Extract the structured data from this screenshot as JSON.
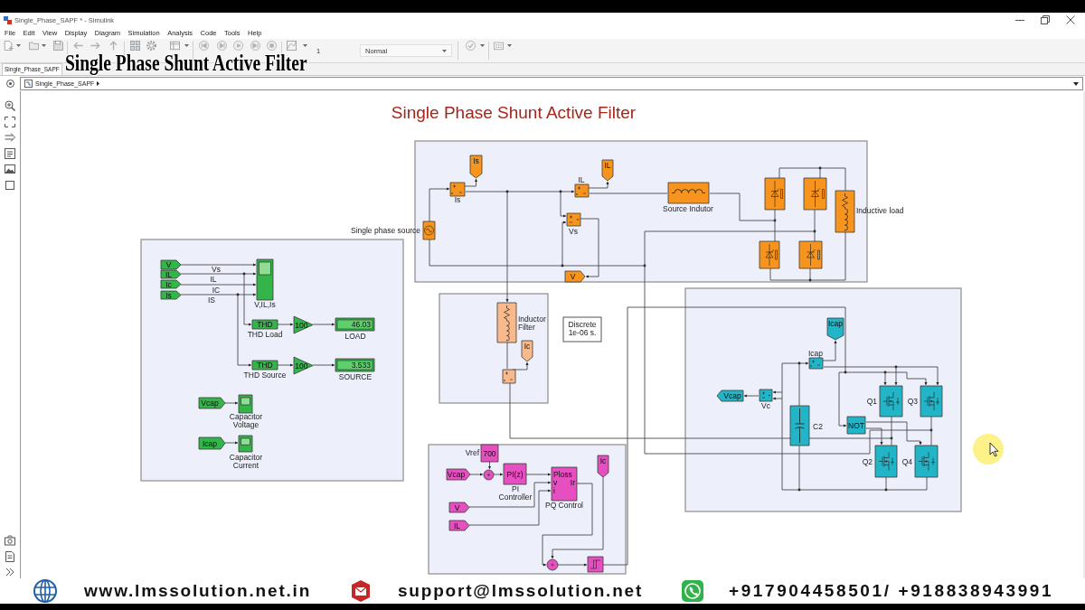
{
  "window": {
    "title": "Single_Phase_SAPF * - Simulink"
  },
  "menu": [
    "File",
    "Edit",
    "View",
    "Display",
    "Diagram",
    "Simulation",
    "Analysis",
    "Code",
    "Tools",
    "Help"
  ],
  "toolbar": {
    "stop_time": "1",
    "simulation_mode": "Normal"
  },
  "overlay_title": "Single Phase Shunt Active Filter",
  "tabs": [
    {
      "label": "Single_Phase_SAPF",
      "selected": true
    }
  ],
  "address_bar": {
    "path": [
      "Single_Phase_SAPF"
    ]
  },
  "diagram": {
    "title": "Single Phase Shunt Active Filter",
    "solver": [
      "Discrete",
      "1e-06 s."
    ],
    "areas": [
      {
        "color": "#f7941d",
        "blocks": [
          {
            "kind": "tagdown",
            "text": "Is"
          },
          {
            "kind": "tagdown",
            "text": "IL"
          },
          {
            "kind": "ammeter"
          },
          {
            "kind": "ammeter"
          },
          {
            "kind": "inductor"
          },
          {
            "kind": "thyristor"
          },
          {
            "kind": "thyristor"
          },
          {
            "kind": "rlbranch"
          },
          {
            "kind": "voltmeter"
          },
          {
            "kind": "acsource"
          },
          {
            "kind": "thyristor"
          },
          {
            "kind": "thyristor"
          },
          {
            "kind": "tagright",
            "text": "V"
          }
        ],
        "labels": [
          "Single phase source",
          "Is",
          "IL",
          "Vs",
          "Source Indutor",
          "Inductive load"
        ]
      },
      {
        "color": "#33b54a",
        "blocks": [
          {
            "kind": "tagright",
            "text": "V"
          },
          {
            "kind": "tagright",
            "text": "IL"
          },
          {
            "kind": "tagright",
            "text": "Ic"
          },
          {
            "kind": "tagright",
            "text": "Is"
          },
          {
            "kind": "scope"
          },
          {
            "kind": "thd",
            "text": "THD"
          },
          {
            "kind": "gain",
            "text": "100"
          },
          {
            "kind": "display",
            "text": "46.03"
          },
          {
            "kind": "thd",
            "text": "THD"
          },
          {
            "kind": "gain",
            "text": "100"
          },
          {
            "kind": "display",
            "text": "3.533"
          },
          {
            "kind": "tagright",
            "text": "Vcap"
          },
          {
            "kind": "scope"
          },
          {
            "kind": "tagright",
            "text": "Icap"
          },
          {
            "kind": "scope"
          }
        ],
        "labels": [
          "Vs",
          "IL",
          "IC",
          "IS",
          "V,IL,Is",
          "THD Load",
          "LOAD",
          "THD Source",
          "SOURCE",
          [
            "Capacitor",
            "Voltage"
          ],
          [
            "Capacitor",
            "Current"
          ]
        ]
      },
      {
        "color": "#f9b98a",
        "blocks": [
          {
            "kind": "rlbranch"
          },
          {
            "kind": "tagdown",
            "text": "Ic"
          },
          {
            "kind": "ammeter"
          }
        ],
        "labels": [
          [
            "Inductor",
            "Filter"
          ]
        ]
      },
      {
        "color": "#22b5c7",
        "blocks": [
          {
            "kind": "tagdown",
            "text": "Icap"
          },
          {
            "kind": "ammeter"
          },
          {
            "kind": "tagleft",
            "text": "Vcap"
          },
          {
            "kind": "voltmeter"
          },
          {
            "kind": "mosfet"
          },
          {
            "kind": "mosfet"
          },
          {
            "kind": "capacitor"
          },
          {
            "kind": "not",
            "text": "NOT"
          },
          {
            "kind": "mosfet"
          },
          {
            "kind": "mosfet"
          }
        ],
        "labels": [
          "Icap",
          "Vc",
          "Q1",
          "Q3",
          "C2",
          "Q2",
          "Q4"
        ]
      },
      {
        "color": "#e64fbf",
        "blocks": [
          {
            "kind": "constant",
            "text": "700"
          },
          {
            "kind": "tagdown",
            "text": "Ic"
          },
          {
            "kind": "tagright",
            "text": "Vcap"
          },
          {
            "kind": "sum"
          },
          {
            "kind": "pi",
            "text": "PI(z)"
          },
          {
            "kind": "pq",
            "ports": [
              "Ploss",
              "v",
              "i",
              "Ir"
            ]
          },
          {
            "kind": "tagright",
            "text": "V"
          },
          {
            "kind": "tagright",
            "text": "IL"
          },
          {
            "kind": "sum"
          },
          {
            "kind": "relay"
          }
        ],
        "labels": [
          "Vref",
          [
            "PI",
            "Controller"
          ],
          "PQ Control"
        ]
      }
    ]
  },
  "banner": {
    "website": "www.lmssolution.net.in",
    "email": "support@lmssolution.net",
    "phone": "+917904458501/ +918838943991"
  }
}
